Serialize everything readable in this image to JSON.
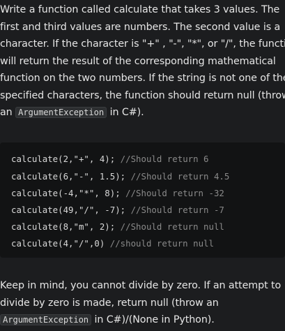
{
  "description": {
    "lines": [
      "Write a function called calculate that takes 3 values. The",
      "first and third values are numbers. The second value is a",
      "character. If the character is \"+\" , \"-\", \"*\", or \"/\", the function",
      "will return the result of the corresponding mathematical",
      "function on the two numbers. If the string is not one of the",
      "specified characters, the function should return null (throw"
    ],
    "last_line_prefix": "an",
    "last_line_code": "ArgumentException",
    "last_line_suffix": "in C#)."
  },
  "code_block": {
    "lines": [
      {
        "code": "calculate(2,\"+\", 4);",
        "comment": "//Should return 6"
      },
      {
        "code": "calculate(6,\"-\", 1.5);",
        "comment": "//Should return 4.5"
      },
      {
        "code": "calculate(-4,\"*\", 8);",
        "comment": "//Should return -32"
      },
      {
        "code": "calculate(49,\"/\", -7);",
        "comment": "//Should return -7"
      },
      {
        "code": "calculate(8,\"m\", 2);",
        "comment": "//Should return null"
      },
      {
        "code": "calculate(4,\"/\",0)",
        "comment": "//should return null"
      }
    ]
  },
  "note": {
    "line1": "Keep in mind, you cannot divide by zero. If an attempt to",
    "line2": "divide by zero is made, return null (throw an",
    "line3_code": "ArgumentException",
    "line3_suffix": "in C#)/(None in Python)."
  },
  "colors": {
    "background": "#1c1d1f",
    "code_background": "#121314",
    "text": "#e6e6e6",
    "comment": "#8a8a8a"
  }
}
